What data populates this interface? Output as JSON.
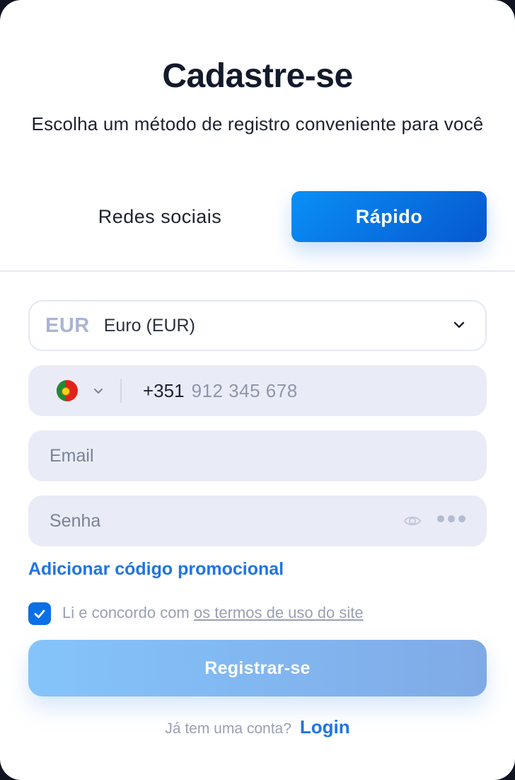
{
  "header": {
    "title": "Cadastre-se",
    "subtitle": "Escolha um método de registro conveniente para você"
  },
  "tabs": {
    "social": "Redes sociais",
    "quick": "Rápido",
    "active": "quick"
  },
  "form": {
    "currency": {
      "code": "EUR",
      "name": "Euro (EUR)"
    },
    "phone": {
      "country_icon": "portugal-flag-icon",
      "prefix": "+351",
      "placeholder": "912 345 678"
    },
    "email": {
      "placeholder": "Email"
    },
    "password": {
      "placeholder": "Senha"
    },
    "promo_link": "Adicionar código promocional",
    "terms": {
      "checked": true,
      "text": "Li e concordo com",
      "link": "os termos de uso do site"
    },
    "submit": "Registrar-se"
  },
  "footer": {
    "question": "Já tem uma conta?",
    "login": "Login"
  },
  "colors": {
    "accent": "#0b6fe8",
    "tab_active_start": "#0a8ff7",
    "tab_active_end": "#0658cf",
    "field_bg": "#e9ecf6",
    "submit_start": "#84c4fb",
    "submit_end": "#80aae6"
  }
}
